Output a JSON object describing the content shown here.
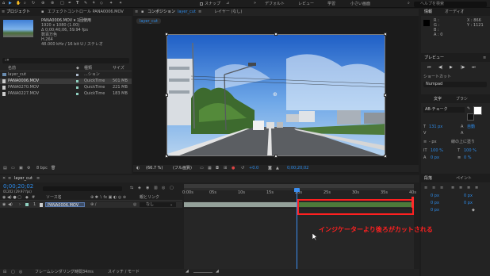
{
  "toolbar": {
    "snap_label": "スナップ",
    "workspaces": [
      "デフォルト",
      "レビュー",
      "学習",
      "小さい画面"
    ],
    "help_placeholder": "ヘルプを検索"
  },
  "project_panel": {
    "title": "プロジェクト",
    "effect_tab": "エフェクトコントロール PANA0006.MOV",
    "info_lines": [
      "PANA0006.MOV ▾ 1回使用",
      "1920 x 1080 (1.00)",
      "Δ 0;00;40;06, 59.94 fps",
      "数百万色",
      "H.264",
      "48.000 kHz / 16 bit U / ステレオ"
    ],
    "search_placeholder": "⌕▾",
    "columns": {
      "name": "名前",
      "type": "種類",
      "size": "サイズ"
    },
    "items": [
      {
        "name": "layer_cut",
        "type": "...ション",
        "size": ""
      },
      {
        "name": "PANA0006.MOV",
        "type": "QuickTime",
        "size": "501 MB"
      },
      {
        "name": "PANA0270.MOV",
        "type": "QuickTime",
        "size": "221 MB"
      },
      {
        "name": "PANA0227.MOV",
        "type": "QuickTime",
        "size": "183 MB"
      }
    ],
    "bpc": "8 bpc"
  },
  "comp_panel": {
    "title": "コンポジション",
    "comp_name": "layer_cut",
    "layer_tab": "レイヤー (なし)",
    "crumb": "layer_cut",
    "zoom": "(66.7 %)",
    "resolution": "(フル画質)",
    "timecode": "0;00;20;02",
    "exposure": "+0.0"
  },
  "info_panel": {
    "title": "情報",
    "audio": "オーディオ",
    "values": [
      "R :",
      "G :",
      "B :",
      "A : 0"
    ],
    "coords": [
      "X : 866",
      "Y : 1121"
    ]
  },
  "preview_panel": {
    "title": "プレビュー",
    "shortcut_label": "ショートカット",
    "shortcut_value": "Numpad"
  },
  "char_panel": {
    "tab1": "文字",
    "tab2": "ブラシ",
    "font": "AB-チョーク",
    "size": "131 px",
    "auto": "自動",
    "px": "- px",
    "stroke": "線の上に塗り",
    "scale_v": "100 %",
    "scale_h": "100 %",
    "baseline": "0 px",
    "tsume": "0 %"
  },
  "align_panel": {
    "tab1": "段落",
    "tab2": "ペイント",
    "values": [
      "0 px",
      "0 px",
      "0 px",
      "0 px",
      "0 px"
    ]
  },
  "timeline": {
    "comp_name": "layer_cut",
    "timecode": "0;00;20;02",
    "timecode_sub": "01202 (29.97 fps)",
    "col_source": "ソース名",
    "col_parent": "親とリンク",
    "layer_num": "1",
    "layer_name": "PANA0006.MOV",
    "parent_value": "なし",
    "ticks": [
      "0:00s",
      "05s",
      "10s",
      "15s",
      "20s",
      "25s",
      "30s",
      "35s",
      "40s"
    ],
    "footer_render": "フレームレンダリング時間",
    "footer_render_value": "34ms",
    "footer_switch": "スイッチ / モード"
  },
  "annotation": {
    "text": "インジケーターより後ろがカットされる",
    "color": "#ff2020"
  }
}
